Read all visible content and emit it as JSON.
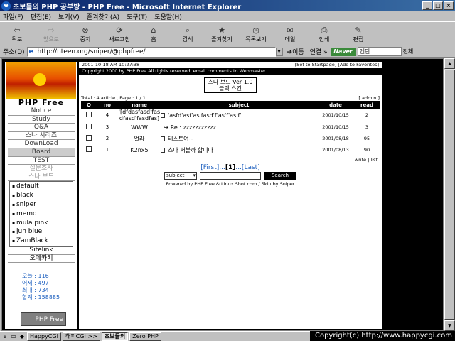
{
  "window": {
    "title": "초보들의 PHP 공부방 - PHP Free - Microsoft Internet Explorer",
    "buttons": [
      "_",
      "□",
      "×"
    ]
  },
  "menubar": {
    "items": [
      "파일(F)",
      "편집(E)",
      "보기(V)",
      "즐겨찾기(A)",
      "도구(T)",
      "도움말(H)"
    ]
  },
  "toolbar": {
    "buttons": [
      {
        "label": "뒤로",
        "icon": "back-arrow-icon",
        "glyph": "⇦",
        "enabled": true
      },
      {
        "label": "앞으로",
        "icon": "forward-arrow-icon",
        "glyph": "⇨",
        "enabled": false
      },
      {
        "label": "중지",
        "icon": "stop-icon",
        "glyph": "⊗",
        "enabled": true
      },
      {
        "label": "새로고침",
        "icon": "refresh-icon",
        "glyph": "⟳",
        "enabled": true
      },
      {
        "label": "홈",
        "icon": "home-icon",
        "glyph": "⌂",
        "enabled": true
      },
      {
        "label": "검색",
        "icon": "search-icon",
        "glyph": "⌕",
        "enabled": true
      },
      {
        "label": "즐겨찾기",
        "icon": "favorites-icon",
        "glyph": "★",
        "enabled": true
      },
      {
        "label": "목록보기",
        "icon": "history-icon",
        "glyph": "◷",
        "enabled": true
      },
      {
        "label": "메일",
        "icon": "mail-icon",
        "glyph": "✉",
        "enabled": true
      },
      {
        "label": "인쇄",
        "icon": "print-icon",
        "glyph": "⎙",
        "enabled": true
      },
      {
        "label": "편집",
        "icon": "edit-icon",
        "glyph": "✎",
        "enabled": true
      }
    ]
  },
  "addressbar": {
    "label": "주소(D)",
    "url": "http://nteen.org/sniper/@phpfree/",
    "go": "이동",
    "links": "연결 »",
    "naver": "Naver",
    "search_value": "엔틴",
    "search_scope": "전체"
  },
  "sidebar": {
    "site_name": "PHP Free",
    "menu": [
      {
        "label": "Notice",
        "style": "normal"
      },
      {
        "label": "Study",
        "style": "normal"
      },
      {
        "label": "Q&A",
        "style": "normal"
      },
      {
        "label": "스나 시리즈",
        "style": "normal"
      },
      {
        "label": "DownLoad",
        "style": "normal"
      },
      {
        "label": "Board",
        "style": "dark"
      },
      {
        "label": "TEST",
        "style": "normal"
      },
      {
        "label": "설문조사",
        "style": "gray"
      },
      {
        "label": "스나 보드",
        "style": "gray"
      }
    ],
    "skins": [
      "default",
      "black",
      "sniper",
      "memo",
      "mula pink",
      "jun blue",
      "ZamBlack"
    ],
    "menu2": [
      "Sitelink",
      "오메카키"
    ],
    "stats": [
      "오늘 : 116",
      "어제 : 497",
      "최대 : 734",
      "합계 : 158885"
    ],
    "logo_text": "PHP Free"
  },
  "main": {
    "date": "2001-10-18 AM 10:27:38",
    "top_links": "[Set to Startpage] [Add to Favorites]",
    "copyright": "Copyright 2000 by PHP Free All rights reserved. email comments to Webmaster.",
    "board_title_1": "스나 보드 Ver 1.0",
    "board_title_2": "블랙 스킨",
    "total": "Total : 4 article , Page : 1 / 1",
    "admin": "[ admin ]",
    "headers": [
      "O",
      "no",
      "name",
      "subject",
      "date",
      "read"
    ],
    "rows": [
      {
        "no": "4",
        "name": "'[dfdasfasd'fasdfasd'fasdfas]",
        "subject": "'asfd'asf'as'fasd'f'as'f'as'f'",
        "date": "2001/10/15",
        "read": "2",
        "reply": false
      },
      {
        "no": "3",
        "name": "WWW",
        "subject": "Re : zzzzzzzzzzz",
        "date": "2001/10/15",
        "read": "3",
        "reply": true
      },
      {
        "no": "2",
        "name": "얼라",
        "subject": "테스트여~",
        "date": "2001/08/18",
        "read": "95",
        "reply": false
      },
      {
        "no": "1",
        "name": "K2nx5",
        "subject": "스나 써볼까 합니다",
        "date": "2001/08/13",
        "read": "90",
        "reply": false
      }
    ],
    "write_list": "write | list",
    "pager_first": "[First]...",
    "pager_current": "[1]",
    "pager_last": "...[Last]",
    "search_select": "subject",
    "search_button": "Search",
    "powered": "Powered by PHP Free & Linux Shot.com / Skin by Sniper"
  },
  "taskbar": {
    "tasks": [
      {
        "label": "HappyCGI",
        "active": false
      },
      {
        "label": "해피CGI >>",
        "active": false
      },
      {
        "label": "초보들의",
        "active": true
      },
      {
        "label": "Zero PHP",
        "active": false
      }
    ],
    "watermark": "Copyright(c) http://www.happycgi.com"
  }
}
